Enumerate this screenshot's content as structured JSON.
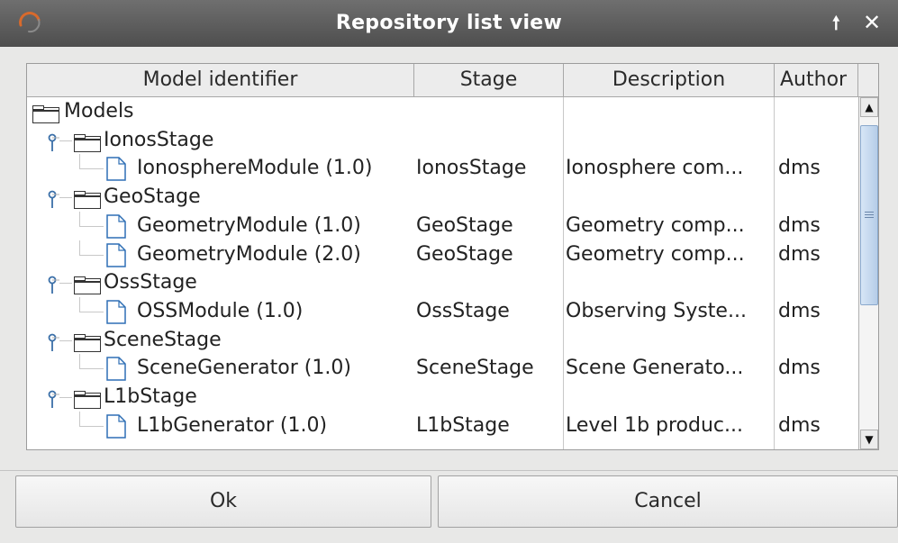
{
  "window": {
    "title": "Repository list view",
    "maximize_glyph": "🠕",
    "close_glyph": "✕"
  },
  "table": {
    "columns": [
      "Model identifier",
      "Stage",
      "Description",
      "Author"
    ],
    "root": "Models",
    "groups": [
      {
        "name": "IonosStage",
        "children": [
          {
            "id": "IonosphereModule (1.0)",
            "stage": "IonosStage",
            "description": "Ionosphere com...",
            "author": "dms"
          }
        ]
      },
      {
        "name": "GeoStage",
        "children": [
          {
            "id": "GeometryModule (1.0)",
            "stage": "GeoStage",
            "description": "Geometry comp...",
            "author": "dms"
          },
          {
            "id": "GeometryModule (2.0)",
            "stage": "GeoStage",
            "description": "Geometry comp...",
            "author": "dms"
          }
        ]
      },
      {
        "name": "OssStage",
        "children": [
          {
            "id": "OSSModule (1.0)",
            "stage": "OssStage",
            "description": "Observing Syste...",
            "author": "dms"
          }
        ]
      },
      {
        "name": "SceneStage",
        "children": [
          {
            "id": "SceneGenerator (1.0)",
            "stage": "SceneStage",
            "description": "Scene Generato...",
            "author": "dms"
          }
        ]
      },
      {
        "name": "L1bStage",
        "children": [
          {
            "id": "L1bGenerator (1.0)",
            "stage": "L1bStage",
            "description": "Level 1b produc...",
            "author": "dms"
          }
        ]
      }
    ]
  },
  "buttons": {
    "ok_label": "Ok",
    "cancel_label": "Cancel"
  },
  "icons": {
    "app": "app-logo-icon",
    "folder": "folder-icon",
    "document": "document-icon",
    "tree_handle": "tree-expand-handle-icon",
    "scroll_up": "scroll-up-arrow-icon",
    "scroll_down": "scroll-down-arrow-icon"
  },
  "colors": {
    "titlebar": "#5a5a5a",
    "window_bg": "#e8e8e7",
    "scroll_thumb": "#c6d9ef"
  }
}
